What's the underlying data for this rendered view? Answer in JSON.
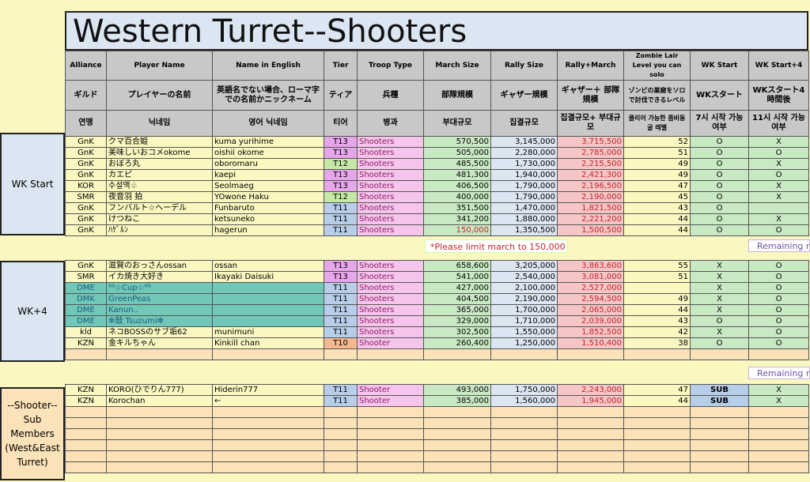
{
  "title": "Western Turret--Shooters",
  "headers": {
    "en": [
      "Alliance",
      "Player Name",
      "Name in English",
      "Tier",
      "Troop Type",
      "March Size",
      "Rally Size",
      "Rally+March",
      "Zombie Lair Level you can solo",
      "WK Start",
      "WK Start+4"
    ],
    "ja": [
      "ギルド",
      "プレイヤーの名前",
      "英語名でない場合、ローマ字での名前かニックネーム",
      "ティア",
      "兵種",
      "部隊規模",
      "ギャザー規模",
      "ギャザー＋ 部隊規模",
      "ゾンビの巣窟をソロで討伐できるレベル",
      "WKスタート",
      "WKスタート4時間後"
    ],
    "ko": [
      "연맹",
      "닉네임",
      "영어 닉네임",
      "티어",
      "병과",
      "부대규모",
      "집결규모",
      "집결규모+ 부대규모",
      "클리어 가능한 좀비동굴 레벨",
      "7시 시작 가능 여부",
      "11시 시작 가능 여부"
    ]
  },
  "sections": {
    "wk_start_label": "WK Start",
    "wk4_label": "WK+4",
    "sub_label": "--Shooter-- Sub Members (West&East Turret)"
  },
  "note": "*Please limit march to 150,000",
  "remaining": "Remaining ro",
  "wk_start_rows": [
    [
      "GnK",
      "クマ百合姫",
      "kuma yurihime",
      "T13",
      "Shooters",
      "570,500",
      "3,145,000",
      "3,715,500",
      "52",
      "O",
      "X"
    ],
    [
      "GnK",
      "美味しいおコメokome",
      "oishii okome",
      "T13",
      "Shooters",
      "505,000",
      "2,280,000",
      "2,785,000",
      "51",
      "O",
      "O"
    ],
    [
      "GnK",
      "おぼろ丸",
      "oboromaru",
      "T12",
      "Shooters",
      "485,500",
      "1,730,000",
      "2,215,500",
      "49",
      "O",
      "X"
    ],
    [
      "GnK",
      "カエピ",
      "kaepi",
      "T13",
      "Shooters",
      "481,300",
      "1,940,000",
      "2,421,300",
      "49",
      "O",
      "O"
    ],
    [
      "KOR",
      "수설맥♧",
      "Seolmaeg",
      "T13",
      "Shooters",
      "406,500",
      "1,790,000",
      "2,196,500",
      "47",
      "O",
      "X"
    ],
    [
      "SMR",
      "夜音羽 拍",
      "YOwone Haku",
      "T12",
      "Shooters",
      "400,000",
      "1,790,000",
      "2,190,000",
      "45",
      "O",
      "X"
    ],
    [
      "GnK",
      "フンバルト☆ヘーデル",
      "Funbaruto",
      "T11",
      "Shooters",
      "351,500",
      "1,470,000",
      "1,821,500",
      "43",
      "O",
      ""
    ],
    [
      "GnK",
      "けつねこ",
      "ketsuneko",
      "T11",
      "Shooters",
      "341,200",
      "1,880,000",
      "2,221,200",
      "44",
      "O",
      "X"
    ],
    [
      "GnK",
      "ﾊｹﾞﾙﾝ",
      "hagerun",
      "T11",
      "Shooters",
      "150,000",
      "1,350,500",
      "1,500,500",
      "44",
      "O",
      "O"
    ]
  ],
  "wk4_rows": [
    [
      "GnK",
      "滋賀のおっさんossan",
      "ossan",
      "T13",
      "Shooters",
      "658,600",
      "3,205,000",
      "3,863,600",
      "55",
      "X",
      "O"
    ],
    [
      "SMR",
      "イカ焼き大好き",
      "Ikayaki Daisuki",
      "T13",
      "Shooters",
      "541,000",
      "2,540,000",
      "3,081,000",
      "51",
      "X",
      "O"
    ],
    [
      "DME",
      "⁶⁹☆Cup☆⁶⁹",
      "",
      "T11",
      "Shooters",
      "427,000",
      "2,100,000",
      "2,527,000",
      "",
      "X",
      "O"
    ],
    [
      "DMK",
      "GreenPeas",
      "",
      "T11",
      "Shooters",
      "404,500",
      "2,190,000",
      "2,594,500",
      "49",
      "X",
      "O"
    ],
    [
      "DME",
      "Kanun..",
      "",
      "T11",
      "Shooters",
      "365,000",
      "1,700,000",
      "2,065,000",
      "44",
      "X",
      "O"
    ],
    [
      "DME",
      "✻鼓 Tsuzumi✻",
      "",
      "T11",
      "Shooters",
      "329,000",
      "1,710,000",
      "2,039,000",
      "43",
      "O",
      "O"
    ],
    [
      "kld",
      "ネコBOSSのサブ垢62",
      "munimuni",
      "T11",
      "Shooters",
      "302,500",
      "1,550,000",
      "1,852,500",
      "42",
      "X",
      "O"
    ],
    [
      "KZN",
      "金キルちゃん",
      "Kinkill chan",
      "T10",
      "Shooter",
      "260,400",
      "1,250,000",
      "1,510,400",
      "38",
      "O",
      "O"
    ]
  ],
  "sub_rows": [
    [
      "KZN",
      "KORO(ひでりん777)",
      "Hiderin777",
      "T11",
      "Shooter",
      "493,000",
      "1,750,000",
      "2,243,000",
      "47",
      "SUB",
      "X"
    ],
    [
      "KZN",
      "Korochan",
      "←",
      "T11",
      "Shooter",
      "385,000",
      "1,560,000",
      "1,945,000",
      "44",
      "SUB",
      "X"
    ]
  ]
}
